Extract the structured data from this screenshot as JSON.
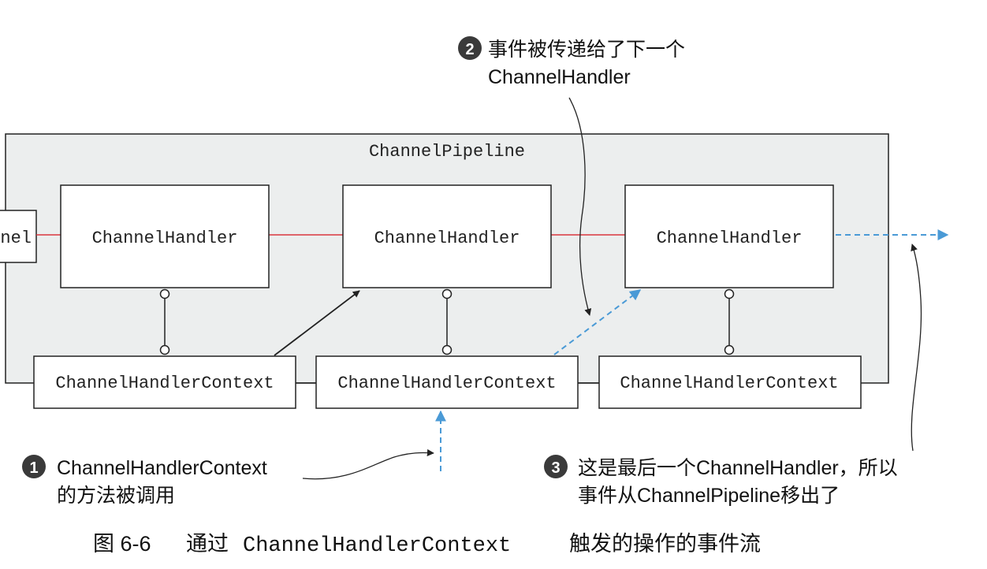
{
  "pipeline": {
    "label": "ChannelPipeline",
    "channel_partial": "nel"
  },
  "handlers": [
    {
      "label": "ChannelHandler"
    },
    {
      "label": "ChannelHandler"
    },
    {
      "label": "ChannelHandler"
    }
  ],
  "contexts": [
    {
      "label": "ChannelHandlerContext"
    },
    {
      "label": "ChannelHandlerContext"
    },
    {
      "label": "ChannelHandlerContext"
    }
  ],
  "callouts": {
    "c1": {
      "num": "1",
      "line1": "ChannelHandlerContext",
      "line2": "的方法被调用"
    },
    "c2": {
      "num": "2",
      "line1": "事件被传递给了下一个",
      "line2": "ChannelHandler"
    },
    "c3": {
      "num": "3",
      "line1": "这是最后一个ChannelHandler，所以",
      "line2": "事件从ChannelPipeline移出了"
    }
  },
  "caption": {
    "prefix": "图 6-6",
    "text1": "通过",
    "code": "ChannelHandlerContext",
    "text2": "触发的操作的事件流"
  },
  "colors": {
    "pipeline_fill": "#eceeee",
    "red_line": "#d9363e",
    "blue_arrow": "#4a9ad6",
    "dark": "#222222",
    "callout_circle": "#3a3a3a"
  }
}
